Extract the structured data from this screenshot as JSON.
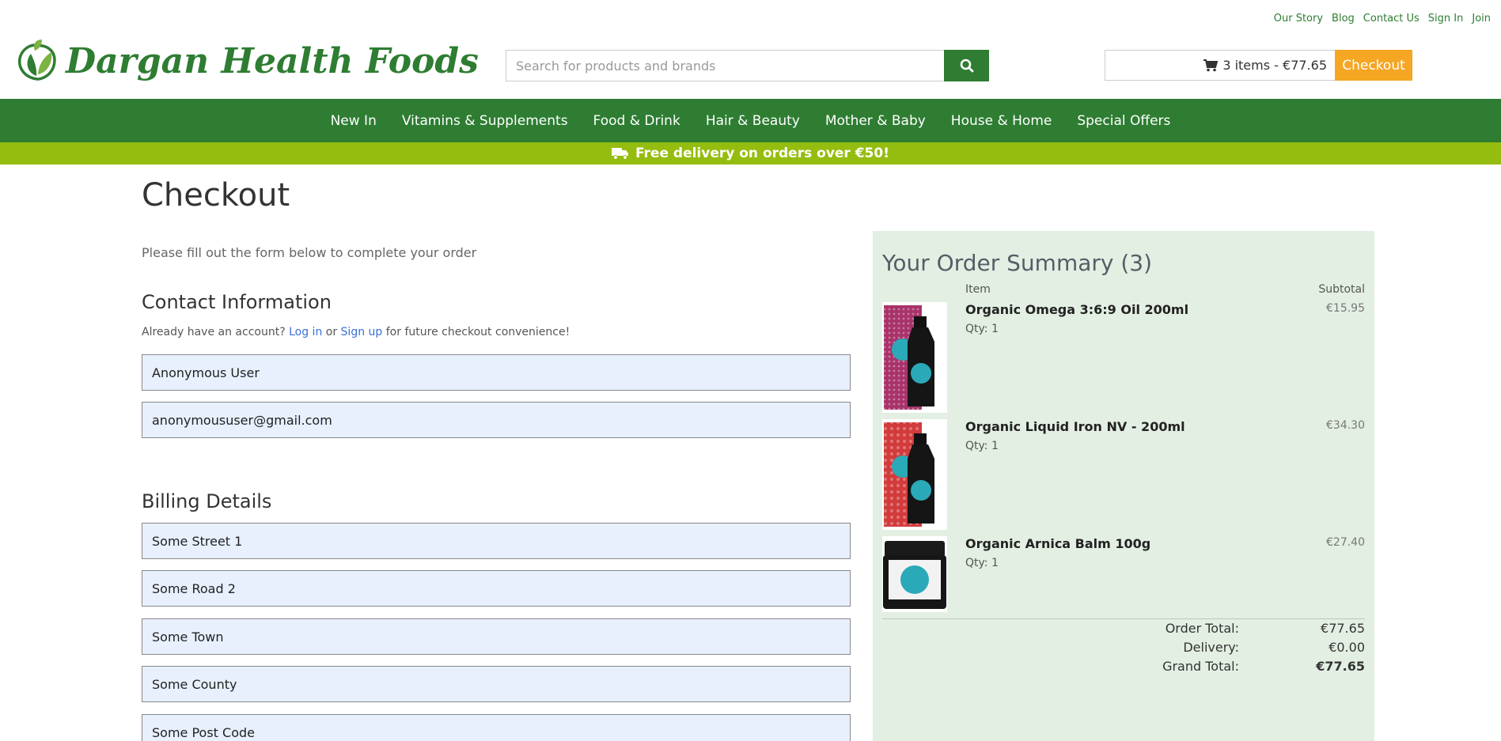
{
  "utility_links": [
    "Our Story",
    "Blog",
    "Contact Us",
    "Sign In",
    "Join"
  ],
  "brand": {
    "name": "Dargan Health Foods",
    "color": "#2e7d32"
  },
  "search": {
    "placeholder": "Search for products and brands",
    "icon": "search-icon"
  },
  "cart": {
    "summary": "3 items - €77.65",
    "icon": "cart-icon",
    "checkout_label": "Checkout",
    "checkout_color": "#f5a623"
  },
  "nav": {
    "items": [
      "New In",
      "Vitamins & Supplements",
      "Food & Drink",
      "Hair & Beauty",
      "Mother & Baby",
      "House & Home",
      "Special Offers"
    ]
  },
  "promo": {
    "text": "Free delivery on orders over €50!",
    "icon": "truck-icon",
    "color": "#95bd0f"
  },
  "checkout": {
    "title": "Checkout",
    "intro": "Please fill out the form below to complete your order",
    "contact": {
      "heading": "Contact Information",
      "account_prefix": "Already have an account?",
      "login_label": "Log in",
      "or": "or",
      "signup_label": "Sign up",
      "account_suffix": "for future checkout convenience!",
      "name_value": "Anonymous User",
      "email_value": "anonymoususer@gmail.com"
    },
    "billing": {
      "heading": "Billing Details",
      "address1": "Some Street 1",
      "address2": "Some Road 2",
      "town": "Some Town",
      "county": "Some County",
      "postcode": "Some Post Code"
    }
  },
  "summary": {
    "title": "Your Order Summary (3)",
    "col_item": "Item",
    "col_subtotal": "Subtotal",
    "items": [
      {
        "name": "Organic Omega 3:6:9 Oil 200ml",
        "qty": "Qty: 1",
        "price": "€15.95",
        "thumb": "omega-oil-product-image"
      },
      {
        "name": "Organic Liquid Iron NV - 200ml",
        "qty": "Qty: 1",
        "price": "€34.30",
        "thumb": "liquid-iron-product-image"
      },
      {
        "name": "Organic Arnica Balm 100g",
        "qty": "Qty: 1",
        "price": "€27.40",
        "thumb": "arnica-balm-product-image"
      }
    ],
    "order_total_label": "Order Total:",
    "order_total": "€77.65",
    "delivery_label": "Delivery:",
    "delivery": "€0.00",
    "grand_total_label": "Grand Total:",
    "grand_total": "€77.65",
    "background": "#e3efe3"
  }
}
